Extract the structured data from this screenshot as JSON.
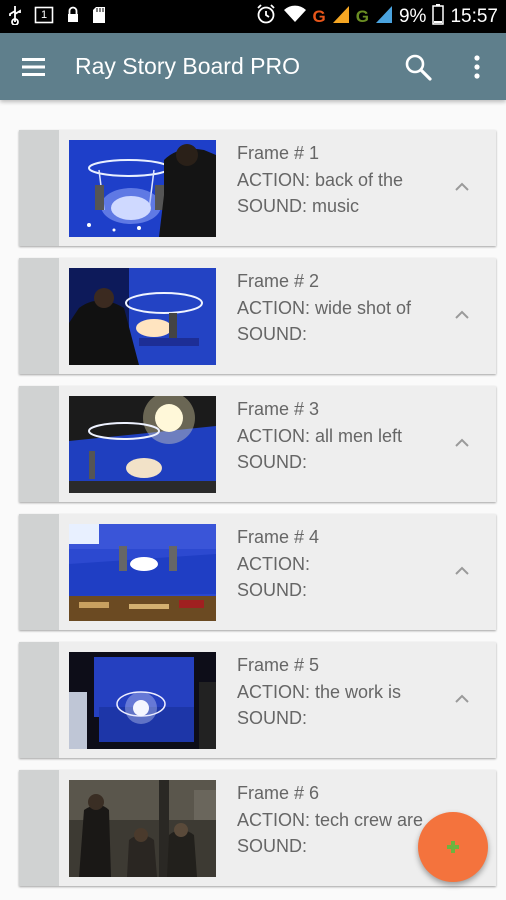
{
  "status_bar": {
    "network_1": "G",
    "network_2": "G",
    "battery": "9%",
    "time": "15:57",
    "notification_badge": "1"
  },
  "app_bar": {
    "title": "Ray Story Board PRO",
    "background": "#5f7f8c"
  },
  "frames": [
    {
      "title": "Frame # 1",
      "action": "ACTION: back of the",
      "sound": "SOUND: music"
    },
    {
      "title": "Frame # 2",
      "action": "ACTION: wide shot of",
      "sound": "SOUND:"
    },
    {
      "title": "Frame # 3",
      "action": "ACTION: all men left",
      "sound": "SOUND:"
    },
    {
      "title": "Frame # 4",
      "action": "ACTION:",
      "sound": "SOUND:"
    },
    {
      "title": "Frame # 5",
      "action": "ACTION: the work is",
      "sound": "SOUND:"
    },
    {
      "title": "Frame # 6",
      "action": "ACTION: tech crew are",
      "sound": "SOUND:"
    }
  ],
  "icons": {
    "menu": "hamburger-menu-icon",
    "search": "search-icon",
    "overflow": "more-vert-icon",
    "collapse": "chevron-up-icon",
    "fab": "plus-icon"
  },
  "colors": {
    "accent": "#f4733d",
    "fab_plus": "#6db33f",
    "card": "#eeeeee",
    "card_strip": "#d0d2d2"
  }
}
